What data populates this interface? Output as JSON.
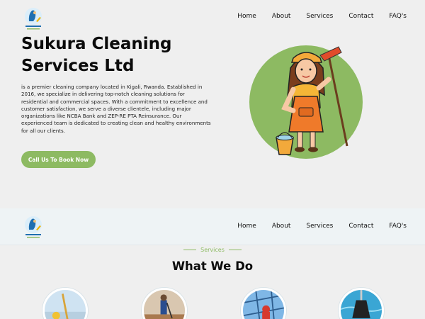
{
  "brand": {
    "name": "Sukura Cleaning Services Ltd"
  },
  "nav": {
    "items": [
      "Home",
      "About",
      "Services",
      "Contact",
      "FAQ's"
    ]
  },
  "hero": {
    "title": "Sukura Cleaning Services Ltd",
    "description": "is a premier cleaning company located in Kigali, Rwanda. Established in 2016, we specialize in delivering top-notch cleaning solutions for residential and commercial spaces. With a commitment to excellence and customer satisfaction, we serve a diverse clientele, including major organizations like NCBA Bank and ZEP-RE PTA Reinsurance. Our experienced team is dedicated to creating clean and healthy environments for all our clients.",
    "cta_label": "Call Us To Book Now"
  },
  "services": {
    "eyebrow": "Services",
    "title": "What We Do"
  },
  "colors": {
    "accent": "#8dba62",
    "background": "#efefef",
    "sticky_nav": "#eef3f5"
  }
}
